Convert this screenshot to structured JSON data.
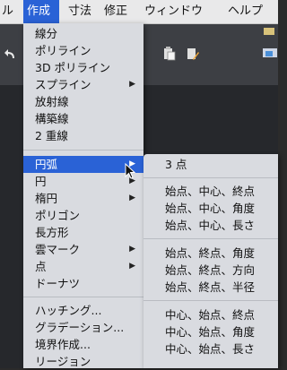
{
  "menubar": {
    "items": [
      "ル",
      "作成",
      "寸法",
      "修正",
      "ウィンドウ",
      "ヘルプ"
    ]
  },
  "menu": {
    "items": [
      {
        "label": "線分"
      },
      {
        "label": "ポリライン"
      },
      {
        "label": "3D ポリライン"
      },
      {
        "label": "スプライン",
        "arrow": "▶"
      },
      {
        "label": "放射線"
      },
      {
        "label": "構築線"
      },
      {
        "label": "2 重線"
      },
      {
        "label": "円弧",
        "arrow": "▶"
      },
      {
        "label": "円",
        "arrow": "▶"
      },
      {
        "label": "楕円",
        "arrow": "▶"
      },
      {
        "label": "ポリゴン"
      },
      {
        "label": "長方形"
      },
      {
        "label": "雲マーク",
        "arrow": "▶"
      },
      {
        "label": "点",
        "arrow": "▶"
      },
      {
        "label": "ドーナツ"
      },
      {
        "label": "ハッチング..."
      },
      {
        "label": "グラデーション..."
      },
      {
        "label": "境界作成..."
      },
      {
        "label": "リージョン"
      }
    ]
  },
  "submenu": {
    "items": [
      "3 点",
      "始点、中心、終点",
      "始点、中心、角度",
      "始点、中心、長さ",
      "始点、終点、角度",
      "始点、終点、方向",
      "始点、終点、半径",
      "中心、始点、終点",
      "中心、始点、角度",
      "中心、始点、長さ"
    ]
  },
  "colors": {
    "highlight": "#2a62d6",
    "menu_bg": "#d9dbe0"
  }
}
